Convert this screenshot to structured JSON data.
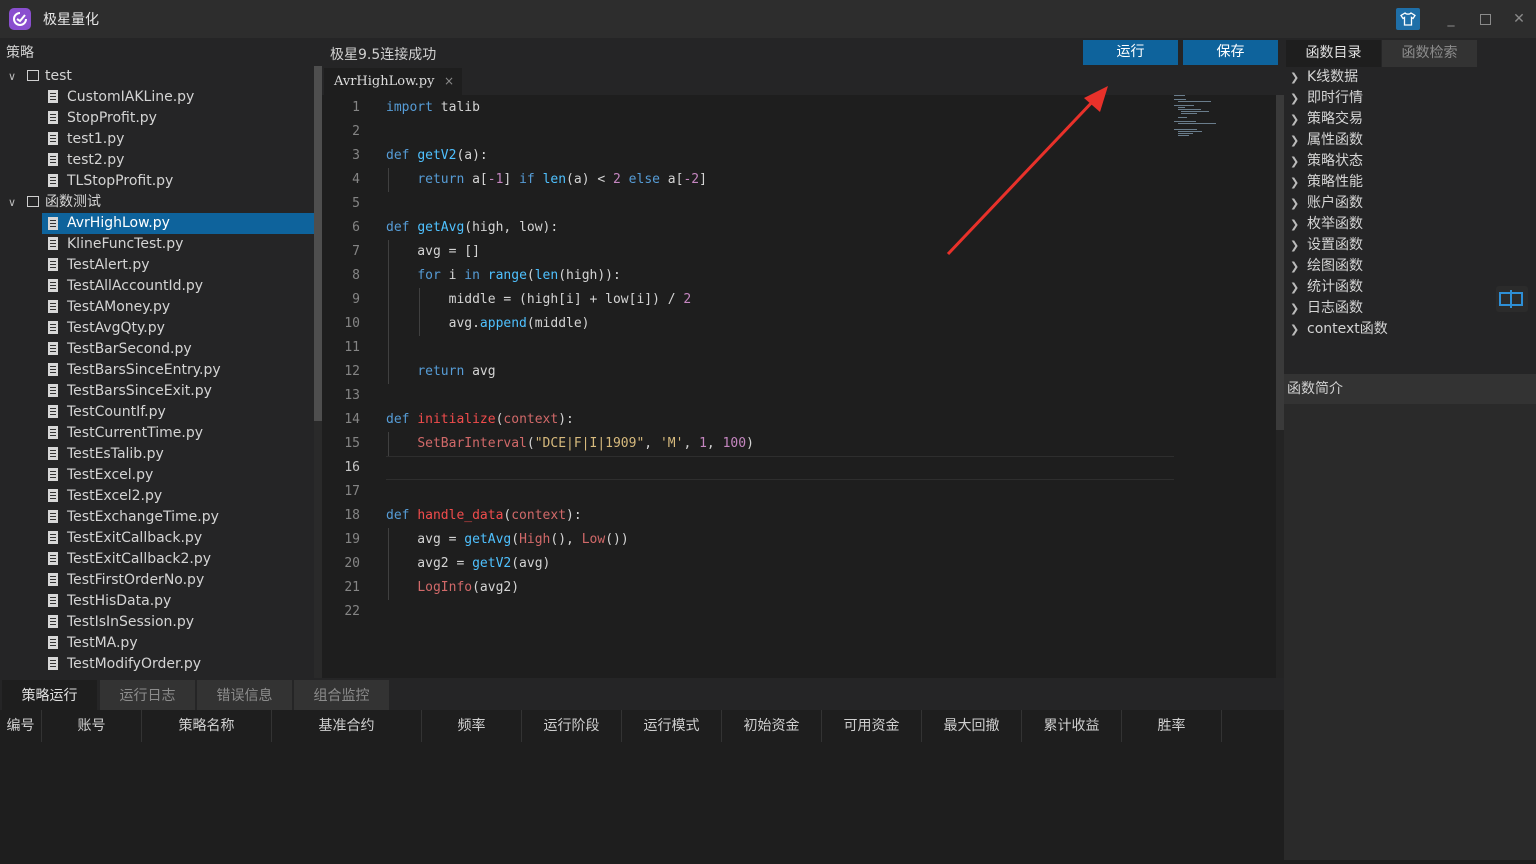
{
  "app": {
    "title": "极星量化"
  },
  "window": {
    "skin_icon": "tshirt-icon",
    "minimize_icon": "minimize-icon",
    "maximize_icon": "maximize-icon",
    "close_icon": "close-icon"
  },
  "left_panel": {
    "header": "策略",
    "folders": [
      {
        "name": "test",
        "files": [
          "CustomIAKLine.py",
          "StopProfit.py",
          "test1.py",
          "test2.py",
          "TLStopProfit.py"
        ]
      },
      {
        "name": "函数测试",
        "files": [
          "AvrHighLow.py",
          "KlineFuncTest.py",
          "TestAlert.py",
          "TestAllAccountId.py",
          "TestAMoney.py",
          "TestAvgQty.py",
          "TestBarSecond.py",
          "TestBarsSinceEntry.py",
          "TestBarsSinceExit.py",
          "TestCountIf.py",
          "TestCurrentTime.py",
          "TestEsTalib.py",
          "TestExcel.py",
          "TestExcel2.py",
          "TestExchangeTime.py",
          "TestExitCallback.py",
          "TestExitCallback2.py",
          "TestFirstOrderNo.py",
          "TestHisData.py",
          "TestIsInSession.py",
          "TestMA.py",
          "TestModifyOrder.py"
        ]
      }
    ],
    "selected_file": "AvrHighLow.py"
  },
  "editor": {
    "status": "极星9.5连接成功",
    "run_label": "运行",
    "save_label": "保存",
    "tab_name": "AvrHighLow.py",
    "tab_close": "×",
    "current_line": 16,
    "lines": [
      "import talib",
      "",
      "def getV2(a):",
      "    return a[-1] if len(a) < 2 else a[-2]",
      "",
      "def getAvg(high, low):",
      "    avg = []",
      "    for i in range(len(high)):",
      "        middle = (high[i] + low[i]) / 2",
      "        avg.append(middle)",
      "",
      "    return avg",
      "",
      "def initialize(context):",
      "    SetBarInterval(\"DCE|F|I|1909\", 'M', 1, 100)",
      "",
      "",
      "def handle_data(context):",
      "    avg = getAvg(High(), Low())",
      "    avg2 = getV2(avg)",
      "    LogInfo(avg2)",
      ""
    ]
  },
  "right_panel": {
    "tabs": [
      "函数目录",
      "函数检索"
    ],
    "categories": [
      "K线数据",
      "即时行情",
      "策略交易",
      "属性函数",
      "策略状态",
      "策略性能",
      "账户函数",
      "枚举函数",
      "设置函数",
      "绘图函数",
      "统计函数",
      "日志函数",
      "context函数"
    ],
    "intro_header": "函数简介",
    "split_icon": "split-view-icon"
  },
  "bottom_panel": {
    "tabs": [
      "策略运行",
      "运行日志",
      "错误信息",
      "组合监控"
    ],
    "columns": [
      "编号",
      "账号",
      "策略名称",
      "基准合约",
      "频率",
      "运行阶段",
      "运行模式",
      "初始资金",
      "可用资金",
      "最大回撤",
      "累计收益",
      "胜率"
    ]
  },
  "colors": {
    "accent": "#0e639c",
    "annotation_arrow": "#e8312a",
    "logo": "#8a4fcf"
  }
}
